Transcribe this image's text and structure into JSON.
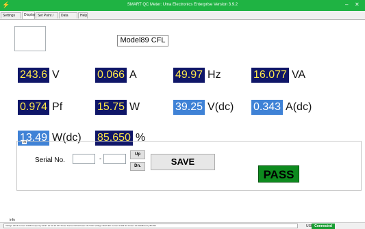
{
  "window": {
    "title": "SMART QC  Meter: Uma Electronics Enterprise  Version 3.9.2",
    "icon": "app-icon",
    "minimize_glyph": "–",
    "close_glyph": "✕"
  },
  "tabs": [
    {
      "label": "Settings",
      "active": false
    },
    {
      "label": "Display",
      "active": true
    },
    {
      "label": "Set Point / Alarm",
      "active": false
    },
    {
      "label": "Data Logger",
      "active": false
    },
    {
      "label": "Help",
      "active": false
    }
  ],
  "model": "Model89 CFL",
  "readings": [
    {
      "value": "243.6",
      "unit": "V",
      "style": "dark"
    },
    {
      "value": "0.066",
      "unit": "A",
      "style": "dark"
    },
    {
      "value": "49.97",
      "unit": "Hz",
      "style": "dark"
    },
    {
      "value": "16.077",
      "unit": "VA",
      "style": "dark"
    },
    {
      "value": "0.974",
      "unit": "Pf",
      "style": "dark"
    },
    {
      "value": "15.75",
      "unit": "W",
      "style": "dark"
    },
    {
      "value": "39.25",
      "unit": "V(dc)",
      "style": "light"
    },
    {
      "value": "0.343",
      "unit": "A(dc)",
      "style": "light"
    },
    {
      "value": "13.49",
      "unit": "W(dc)",
      "style": "light"
    },
    {
      "value": "85.650",
      "unit": "%",
      "style": "dark"
    }
  ],
  "ok_panel": {
    "label": "ok",
    "serial_label": "Serial No.",
    "serial_separator": "-",
    "up_label": "Up",
    "down_label": "Dn.",
    "save_label": "SAVE",
    "result": "PASS"
  },
  "status": {
    "info_label": "info",
    "text": "Voltage 243.6 Current 0.066 Frequency 49.97 Hz VA 16.077 Power Factor 0.974 Power 15.75 DC Voltage 39.25 DC Current 0.343 DC Power 13.49 Efficiency 85.650",
    "usb_label": "USB",
    "usb_state": "Connected"
  },
  "colors": {
    "titlebar": "#1fb343",
    "reading_dark_bg": "#0f1668",
    "reading_dark_fg": "#ffe94a",
    "reading_light_bg": "#3f82d6",
    "pass_bg": "#0d8a1e",
    "usb_connected": "#1a9e33"
  }
}
